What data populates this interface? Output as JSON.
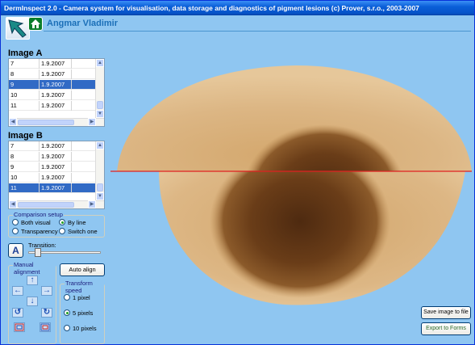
{
  "window": {
    "title": "DermInspect 2.0 - Camera system for visualisation, data storage and diagnostics of pigment lesions (c) Prover, s.r.o., 2003-2007"
  },
  "header": {
    "user_name": "Angmar Vladimir"
  },
  "image_a": {
    "title": "Image A",
    "rows": [
      {
        "num": "7",
        "date": "1.9.2007",
        "selected": false
      },
      {
        "num": "8",
        "date": "1.9.2007",
        "selected": false
      },
      {
        "num": "9",
        "date": "1.9.2007",
        "selected": true
      },
      {
        "num": "10",
        "date": "1.9.2007",
        "selected": false
      },
      {
        "num": "11",
        "date": "1.9.2007",
        "selected": false
      }
    ]
  },
  "image_b": {
    "title": "Image B",
    "rows": [
      {
        "num": "7",
        "date": "1.9.2007",
        "selected": false
      },
      {
        "num": "8",
        "date": "1.9.2007",
        "selected": false
      },
      {
        "num": "9",
        "date": "1.9.2007",
        "selected": false
      },
      {
        "num": "10",
        "date": "1.9.2007",
        "selected": false
      },
      {
        "num": "11",
        "date": "1.9.2007",
        "selected": true
      }
    ]
  },
  "comparison_setup": {
    "label": "Comparison setup",
    "options": [
      {
        "label": "Both visual",
        "selected": false
      },
      {
        "label": "By line",
        "selected": true
      },
      {
        "label": "Transparency",
        "selected": false
      },
      {
        "label": "Switch one",
        "selected": false
      }
    ]
  },
  "transition": {
    "button_label": "A",
    "label": "Transition:",
    "value_fraction": 0.1
  },
  "manual_alignment": {
    "label": "Manual alignment",
    "auto_align_label": "Auto align",
    "arrows": {
      "up": "↑",
      "down": "↓",
      "left": "←",
      "right": "→",
      "rotate_left": "↺",
      "rotate_right": "↻"
    }
  },
  "transform_speed": {
    "label": "Transform speed",
    "options": [
      {
        "label": "1 pixel",
        "selected": false
      },
      {
        "label": "5 pixels",
        "selected": true
      },
      {
        "label": "10 pixels",
        "selected": false
      }
    ]
  },
  "actions": {
    "save_label": "Save image to file",
    "export_label": "Export to Forms"
  },
  "colors": {
    "background": "#8fc6f1",
    "selection": "#316ac5",
    "divider_line": "#e02020",
    "skin": "#d9b27a",
    "lesion": "#5b3414"
  }
}
